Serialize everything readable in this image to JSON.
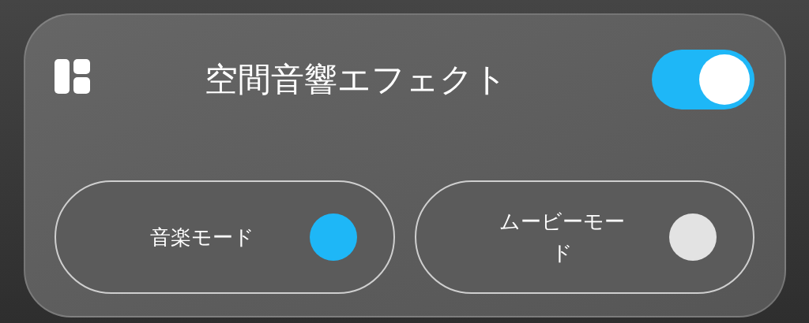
{
  "panel": {
    "title": "空間音響エフェクト",
    "on": true
  },
  "modes": [
    {
      "label": "音楽モード",
      "selected": true
    },
    {
      "label": "ムービーモード",
      "selected": false
    }
  ]
}
